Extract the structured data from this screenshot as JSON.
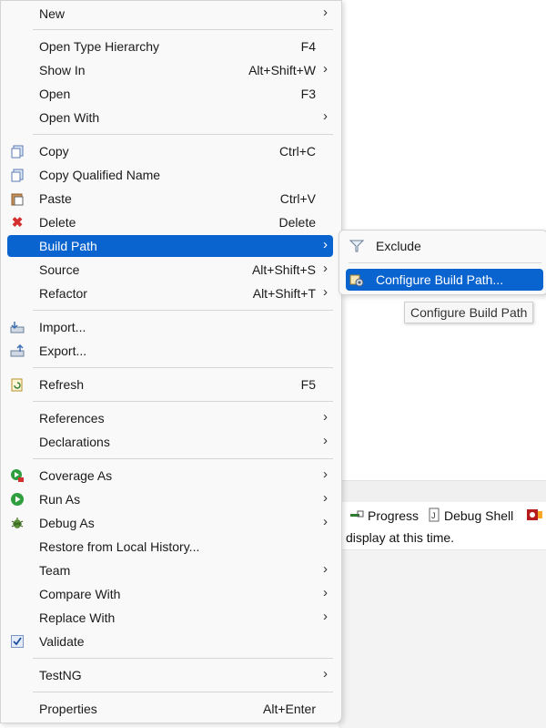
{
  "menu": {
    "new": {
      "label": "New"
    },
    "open_type_hierarchy": {
      "label": "Open Type Hierarchy",
      "shortcut": "F4"
    },
    "show_in": {
      "label": "Show In",
      "shortcut": "Alt+Shift+W"
    },
    "open": {
      "label": "Open",
      "shortcut": "F3"
    },
    "open_with": {
      "label": "Open With"
    },
    "copy": {
      "label": "Copy",
      "shortcut": "Ctrl+C"
    },
    "copy_qualified_name": {
      "label": "Copy Qualified Name"
    },
    "paste": {
      "label": "Paste",
      "shortcut": "Ctrl+V"
    },
    "delete": {
      "label": "Delete",
      "shortcut": "Delete"
    },
    "build_path": {
      "label": "Build Path"
    },
    "source": {
      "label": "Source",
      "shortcut": "Alt+Shift+S"
    },
    "refactor": {
      "label": "Refactor",
      "shortcut": "Alt+Shift+T"
    },
    "import": {
      "label": "Import..."
    },
    "export": {
      "label": "Export..."
    },
    "refresh": {
      "label": "Refresh",
      "shortcut": "F5"
    },
    "references": {
      "label": "References"
    },
    "declarations": {
      "label": "Declarations"
    },
    "coverage_as": {
      "label": "Coverage As"
    },
    "run_as": {
      "label": "Run As"
    },
    "debug_as": {
      "label": "Debug As"
    },
    "restore_local_history": {
      "label": "Restore from Local History..."
    },
    "team": {
      "label": "Team"
    },
    "compare_with": {
      "label": "Compare With"
    },
    "replace_with": {
      "label": "Replace With"
    },
    "validate": {
      "label": "Validate"
    },
    "testng": {
      "label": "TestNG"
    },
    "properties": {
      "label": "Properties",
      "shortcut": "Alt+Enter"
    }
  },
  "submenu": {
    "exclude": {
      "label": "Exclude"
    },
    "configure_build_path": {
      "label": "Configure Build Path..."
    }
  },
  "tooltip": {
    "text": "Configure Build Path"
  },
  "views": {
    "progress": "Progress",
    "debug_shell": "Debug Shell",
    "message": "display at this time."
  },
  "colors": {
    "highlight": "#0a64d0",
    "menu_bg": "#f9f9f9"
  }
}
